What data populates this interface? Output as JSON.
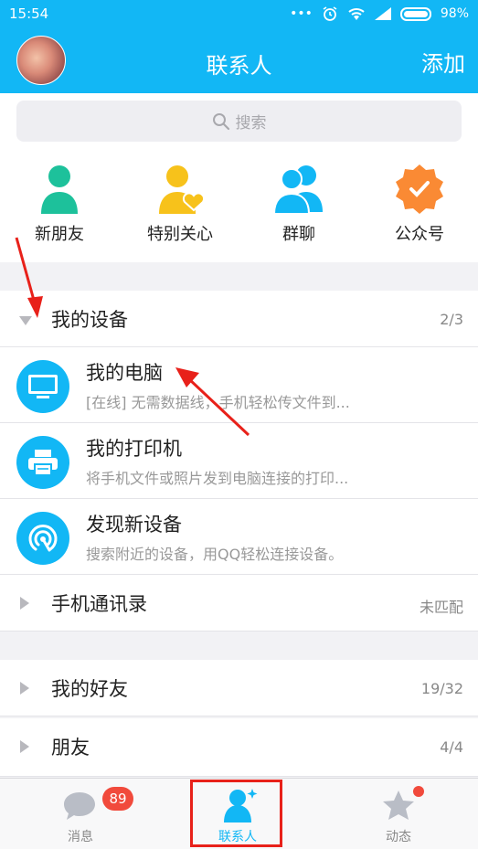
{
  "status_bar": {
    "time": "15:54",
    "icons": [
      "more-dots-icon",
      "alarm-icon",
      "wifi-icon",
      "signal-icon"
    ],
    "battery": "98%"
  },
  "header": {
    "title": "联系人",
    "add_label": "添加"
  },
  "search": {
    "placeholder": "搜索"
  },
  "quick_actions": [
    {
      "label": "新朋友",
      "icon": "new-friend-icon",
      "color": "#1dc19b"
    },
    {
      "label": "特别关心",
      "icon": "special-care-icon",
      "color": "#f7c21b"
    },
    {
      "label": "群聊",
      "icon": "group-chat-icon",
      "color": "#12b7f5"
    },
    {
      "label": "公众号",
      "icon": "official-account-icon",
      "color": "#fa8a34"
    }
  ],
  "groups": {
    "my_devices": {
      "name": "我的设备",
      "count": "2/3"
    },
    "contacts_book": {
      "name": "手机通讯录",
      "count": "未匹配"
    },
    "my_friends": {
      "name": "我的好友",
      "count": "19/32"
    },
    "friends": {
      "name": "朋友",
      "count": "4/4"
    }
  },
  "devices": [
    {
      "name": "我的电脑",
      "desc": "[在线] 无需数据线，手机轻松传文件到...",
      "icon": "computer-icon"
    },
    {
      "name": "我的打印机",
      "desc": "将手机文件或照片发到电脑连接的打印...",
      "icon": "printer-icon"
    },
    {
      "name": "发现新设备",
      "desc": "搜索附近的设备，用QQ轻松连接设备。",
      "icon": "radar-icon"
    }
  ],
  "tabs": [
    {
      "label": "消息",
      "badge": "89",
      "icon": "message-icon"
    },
    {
      "label": "联系人",
      "icon": "contacts-icon",
      "active": true
    },
    {
      "label": "动态",
      "icon": "star-icon",
      "dot": true
    }
  ],
  "colors": {
    "brand": "#12b7f5",
    "badge": "#f14a3c",
    "annotation": "#e8211a"
  }
}
